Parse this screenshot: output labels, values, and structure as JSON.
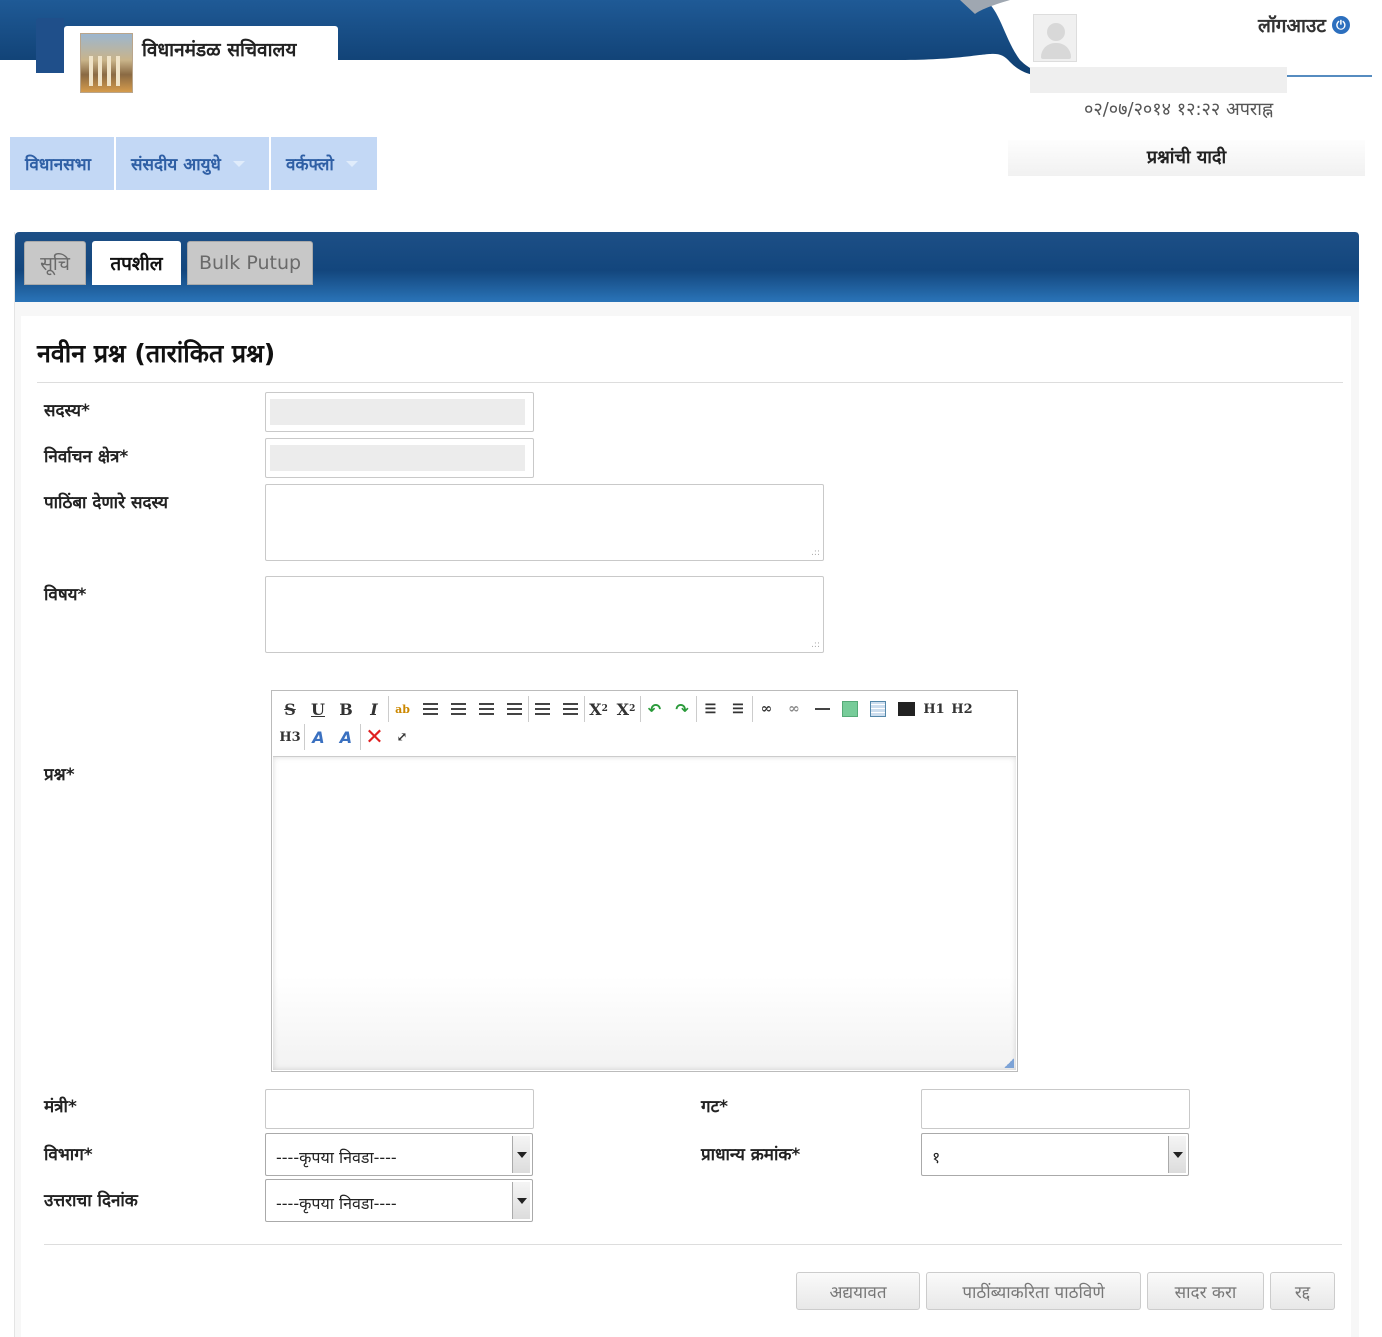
{
  "header": {
    "app_title": "विधानमंडळ सचिवालय",
    "logout_label": "लॉगआउट",
    "datetime": "०२/०७/२०१४ १२:२२ अपराह्न",
    "question_list_link": "प्रश्नांची यादी"
  },
  "nav": {
    "items": [
      {
        "label": "विधानसभा"
      },
      {
        "label": "संसदीय आयुधे"
      },
      {
        "label": "वर्कफ्लो"
      }
    ]
  },
  "tabs": [
    {
      "label": "सूचि",
      "active": false
    },
    {
      "label": "तपशील",
      "active": true
    },
    {
      "label": "Bulk Putup",
      "active": false
    }
  ],
  "form": {
    "title": "नवीन प्रश्न (तारांकित प्रश्न)",
    "labels": {
      "member": "सदस्य*",
      "constituency": "निर्वाचन क्षेत्र*",
      "supporting_members": "पाठिंबा देणारे सदस्य",
      "subject": "विषय*",
      "question": "प्रश्न*",
      "minister": "मंत्री*",
      "group": "गट*",
      "department": "विभाग*",
      "priority": "प्राधान्य क्रमांक*",
      "answer_date": "उत्तराचा दिनांक"
    },
    "department_value": "----कृपया निवडा----",
    "priority_value": "१",
    "answer_date_value": "----कृपया निवडा----"
  },
  "editor": {
    "toolbar_row1": [
      "S",
      "U",
      "B",
      "I",
      "replace",
      "align-center",
      "align-justify",
      "align-left",
      "align-right",
      "indent",
      "outdent",
      "subscript",
      "superscript",
      "undo",
      "redo",
      "ordered-list",
      "unordered-list",
      "link",
      "unlink",
      "hr",
      "image",
      "table",
      "code",
      "H1",
      "H2"
    ],
    "toolbar_row2": [
      "H3",
      "font-color",
      "bg-color",
      "remove-format",
      "fullscreen"
    ]
  },
  "buttons": {
    "update": "अद्ययावत",
    "send_support": "पाठींब्याकरिता पाठविणे",
    "submit": "सादर करा",
    "cancel": "रद्द"
  }
}
